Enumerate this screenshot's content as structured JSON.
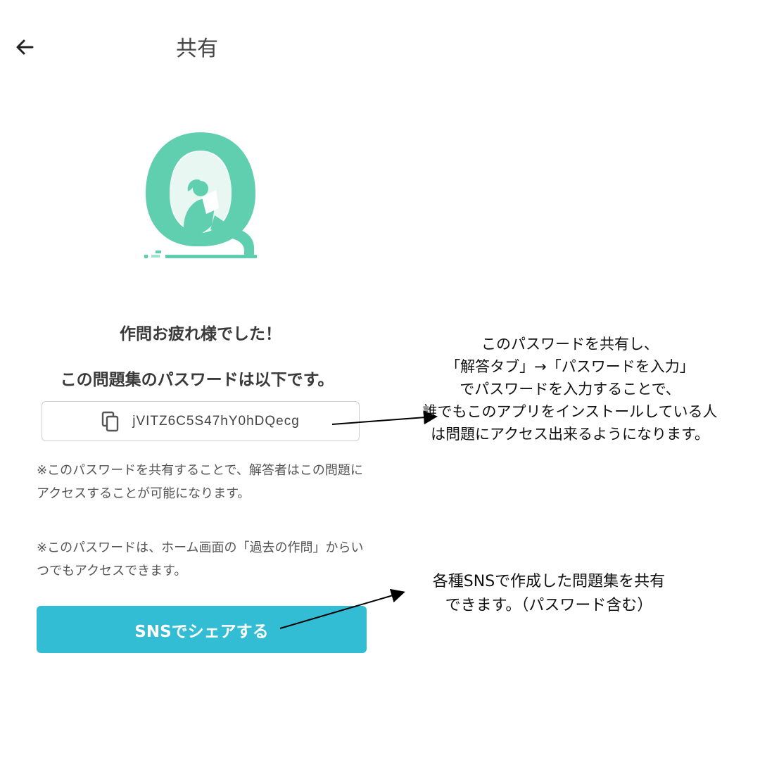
{
  "header": {
    "title": "共有",
    "back_icon": "arrow-left-icon"
  },
  "logo": {
    "name": "q-reading-girl-logo",
    "color": "#5fcfb0"
  },
  "content": {
    "heading1": "作問お疲れ様でした！",
    "heading2": "この問題集のパスワードは以下です。",
    "password": "jVITZ6C5S47hY0hDQecg",
    "copy_icon": "copy-icon",
    "note1": "※このパスワードを共有することで、解答者はこの問題にアクセスすることが可能になります。",
    "note2": "※このパスワードは、ホーム画面の「過去の作問」からいつでもアクセスできます。",
    "sns_button": "SNSでシェアする",
    "sns_button_color": "#33bdd5"
  },
  "annotations": {
    "password_note": [
      "このパスワードを共有し、",
      "「解答タブ」→「パスワードを入力」",
      "でパスワードを入力することで、",
      "誰でもこのアプリをインストールしている人",
      "は問題にアクセス出来るようになります。"
    ],
    "sns_note": [
      "各種SNSで作成した問題集を共有",
      "できます。（パスワード含む）"
    ]
  }
}
